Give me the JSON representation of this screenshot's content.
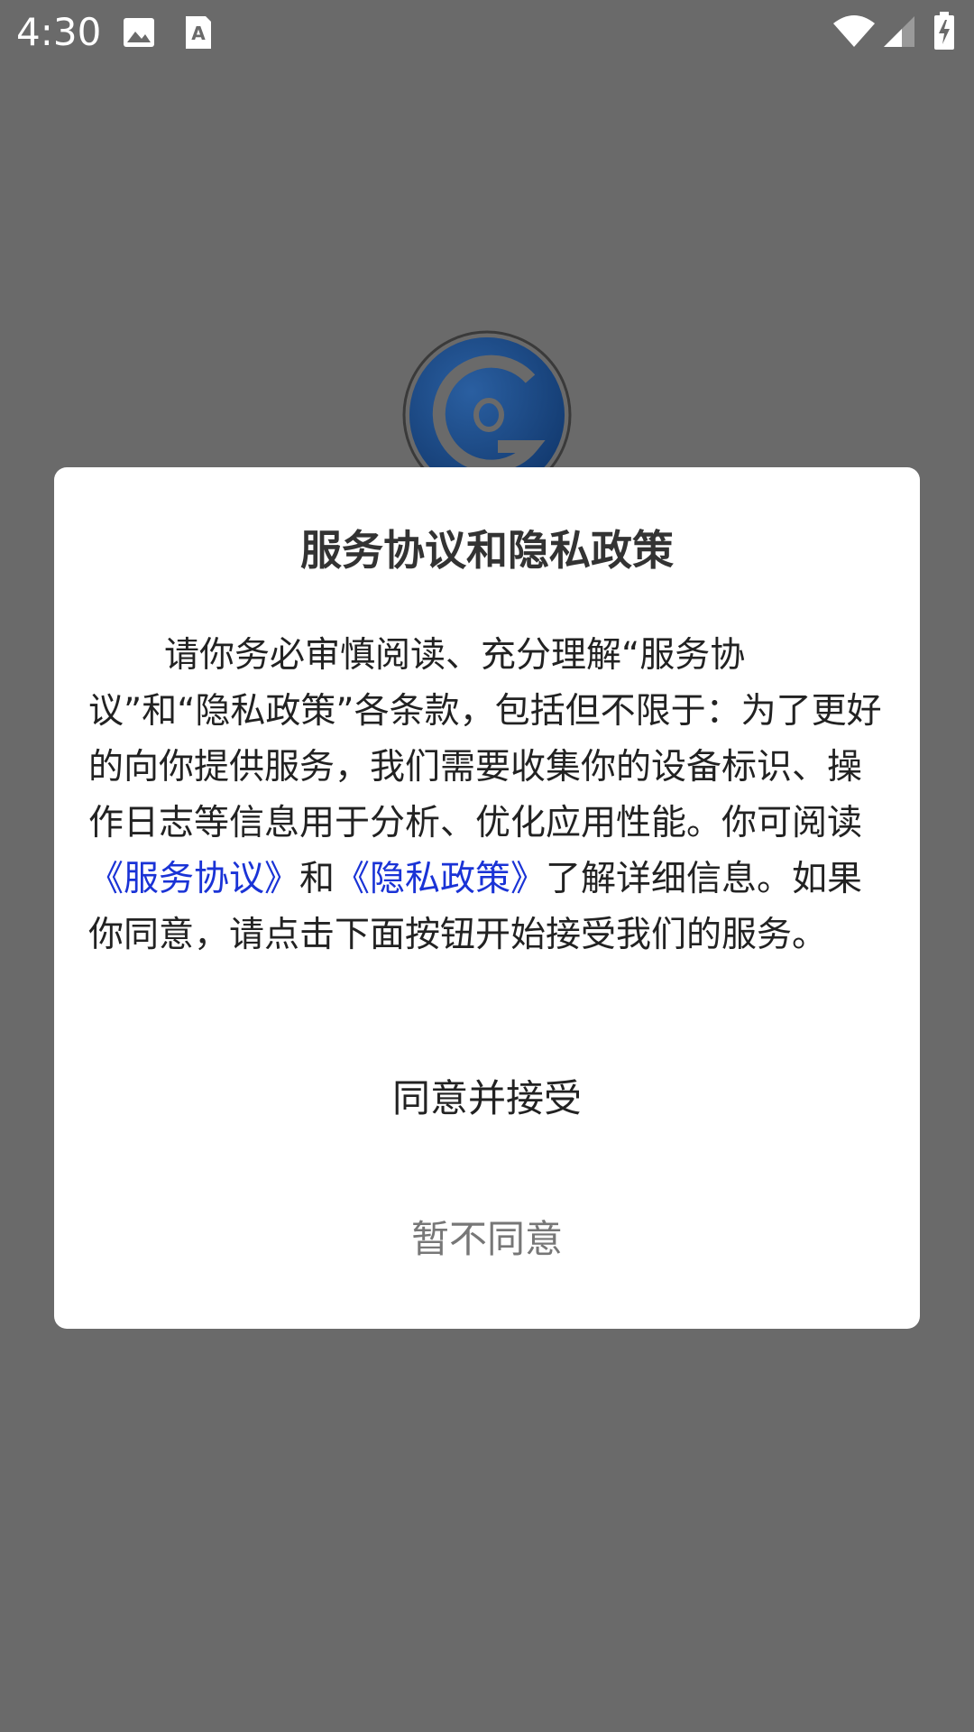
{
  "status_bar": {
    "time": "4:30",
    "icons": [
      "image-icon",
      "a-icon",
      "wifi-icon",
      "signal-icon",
      "battery-charging-icon"
    ]
  },
  "colors": {
    "scrim": "#6a6a6a",
    "dialog_bg": "#ffffff",
    "title": "#333333",
    "link": "#1a33d6",
    "decline_text": "#777777",
    "logo_blue": "#1a4a8a"
  },
  "dialog": {
    "title": "服务协议和隐私政策",
    "body_part1": "请你务必审慎阅读、充分理解“服务协议”和“隐私政策”各条款，包括但不限于：为了更好的向你提供服务，我们需要收集你的设备标识、操作日志等信息用于分析、优化应用性能。你可阅读",
    "link_service": "《服务协议》",
    "body_and": "和",
    "link_privacy": "《隐私政策》",
    "body_part2": "了解详细信息。如果你同意，请点击下面按钮开始接受我们的服务。",
    "agree_label": "同意并接受",
    "decline_label": "暂不同意"
  }
}
